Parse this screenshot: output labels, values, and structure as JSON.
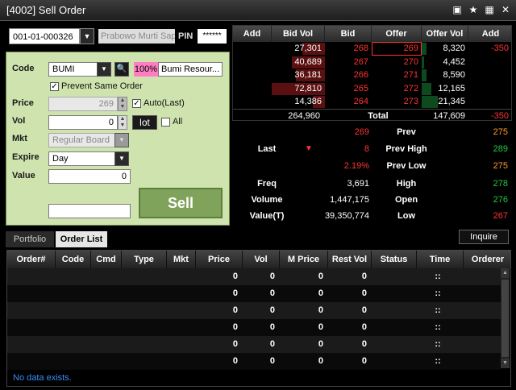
{
  "window": {
    "title": "[4002]  Sell Order",
    "icons": [
      "window-icon",
      "star-icon",
      "grid-icon",
      "close-icon"
    ]
  },
  "account": {
    "number": "001-01-000326",
    "name": "Prabowo Murti Sapu",
    "pin_label": "PIN",
    "pin_value": "******"
  },
  "form": {
    "code_label": "Code",
    "code_value": "BUMI",
    "pct": "100%",
    "stock_name": "Bumi Resour...",
    "prevent_label": "Prevent Same Order",
    "price_label": "Price",
    "price_value": "269",
    "auto_label": "Auto(Last)",
    "vol_label": "Vol",
    "vol_value": "0",
    "lot_label": "lot",
    "all_label": "All",
    "mkt_label": "Mkt",
    "mkt_value": "Regular Board",
    "expire_label": "Expire",
    "expire_value": "Day",
    "value_label": "Value",
    "value_value": "0",
    "memo_value": "",
    "sell_label": "Sell"
  },
  "orderbook": {
    "headers": [
      "Add",
      "Bid Vol",
      "Bid",
      "Offer",
      "Offer Vol",
      "Add"
    ],
    "rows": [
      {
        "bid_vol": "27,301",
        "bid": "268",
        "offer": "269",
        "offer_vol": "8,320",
        "add": "-350",
        "bid_fill": 0.42,
        "offer_fill": 0.1
      },
      {
        "bid_vol": "40,689",
        "bid": "267",
        "offer": "270",
        "offer_vol": "4,452",
        "add": "",
        "bid_fill": 0.62,
        "offer_fill": 0.05
      },
      {
        "bid_vol": "36,181",
        "bid": "266",
        "offer": "271",
        "offer_vol": "8,590",
        "add": "",
        "bid_fill": 0.55,
        "offer_fill": 0.1
      },
      {
        "bid_vol": "72,810",
        "bid": "265",
        "offer": "272",
        "offer_vol": "12,165",
        "add": "",
        "bid_fill": 1.0,
        "offer_fill": 0.2
      },
      {
        "bid_vol": "14,386",
        "bid": "264",
        "offer": "273",
        "offer_vol": "21,345",
        "add": "",
        "bid_fill": 0.22,
        "offer_fill": 0.35
      }
    ],
    "total_bid": "264,960",
    "total_label": "Total",
    "total_offer": "147,609",
    "total_add": "-350"
  },
  "quote": {
    "last_label": "Last",
    "last_price": "269",
    "change": "8",
    "change_pct": "2.19%",
    "prev_label": "Prev",
    "prev_value": "275",
    "prev_high_label": "Prev High",
    "prev_high_value": "289",
    "prev_low_label": "Prev Low",
    "prev_low_value": "275",
    "freq_label": "Freq",
    "freq_value": "3,691",
    "high_label": "High",
    "high_value": "278",
    "volume_label": "Volume",
    "volume_value": "1,447,175",
    "open_label": "Open",
    "open_value": "276",
    "valuet_label": "Value(T)",
    "valuet_value": "39,350,774",
    "low_label": "Low",
    "low_value": "267"
  },
  "tabs": {
    "portfolio": "Portfolio",
    "orderlist": "Order List",
    "inquire": "Inquire"
  },
  "grid": {
    "headers": [
      "Order#",
      "Code",
      "Cmd",
      "Type",
      "Mkt",
      "Price",
      "Vol",
      "M Price",
      "Rest Vol",
      "Status",
      "Time",
      "Orderer"
    ],
    "rows": [
      {
        "price": "0",
        "vol": "0",
        "mprice": "0",
        "restvol": "0",
        "time": "::"
      },
      {
        "price": "0",
        "vol": "0",
        "mprice": "0",
        "restvol": "0",
        "time": "::"
      },
      {
        "price": "0",
        "vol": "0",
        "mprice": "0",
        "restvol": "0",
        "time": "::"
      },
      {
        "price": "0",
        "vol": "0",
        "mprice": "0",
        "restvol": "0",
        "time": "::"
      },
      {
        "price": "0",
        "vol": "0",
        "mprice": "0",
        "restvol": "0",
        "time": "::"
      },
      {
        "price": "0",
        "vol": "0",
        "mprice": "0",
        "restvol": "0",
        "time": "::"
      }
    ],
    "empty_message": "No data exists."
  }
}
